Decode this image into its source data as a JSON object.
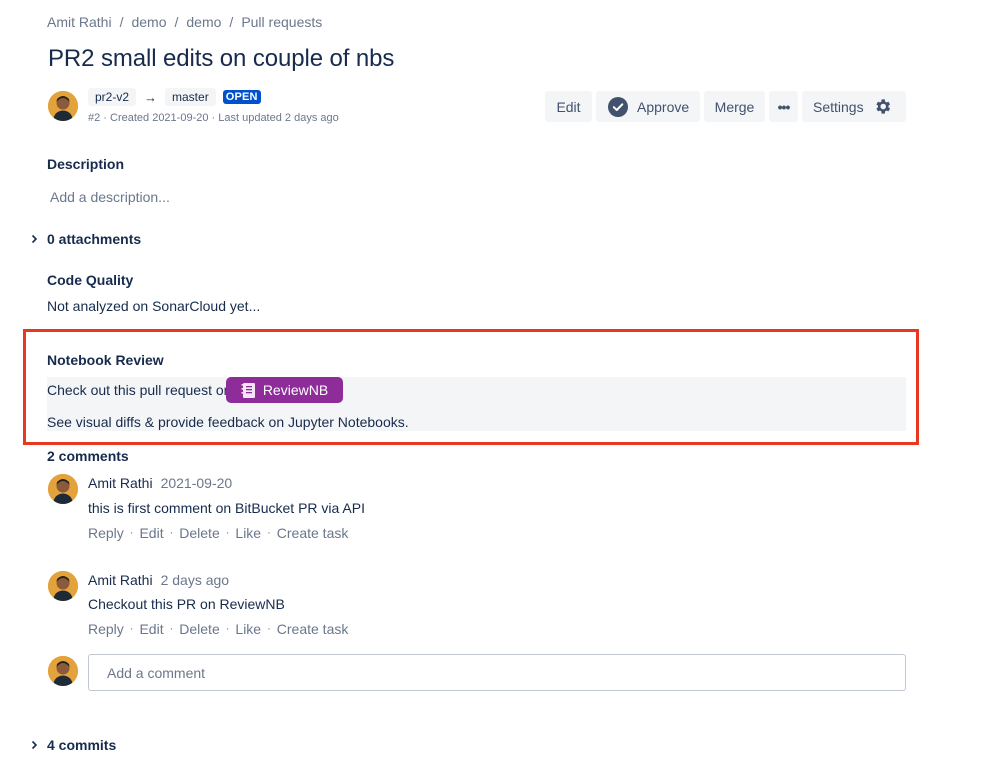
{
  "breadcrumb": [
    "Amit Rathi",
    "demo",
    "demo",
    "Pull requests"
  ],
  "breadcrumb_sep": "/",
  "pr": {
    "title": "PR2 small edits on couple of nbs",
    "source_branch": "pr2-v2",
    "target_branch": "master",
    "status": "OPEN",
    "meta": "#2 · Created 2021-09-20 · Last updated 2 days ago"
  },
  "toolbar": {
    "edit": "Edit",
    "approve": "Approve",
    "merge": "Merge",
    "more": "•••",
    "settings": "Settings"
  },
  "description": {
    "title": "Description",
    "placeholder": "Add a description..."
  },
  "attachments": {
    "label": "0 attachments"
  },
  "code_quality": {
    "title": "Code Quality",
    "text": "Not analyzed on SonarCloud yet..."
  },
  "notebook_review": {
    "title": "Notebook Review",
    "prompt": "Check out this pull request on",
    "button": "ReviewNB",
    "subtext": "See visual diffs & provide feedback on Jupyter Notebooks."
  },
  "comments": {
    "title": "2 comments",
    "items": [
      {
        "author": "Amit Rathi",
        "date": "2021-09-20",
        "text": "this is first comment on BitBucket PR via API"
      },
      {
        "author": "Amit Rathi",
        "date": "2 days ago",
        "text": "Checkout this PR on ReviewNB"
      }
    ],
    "actions": [
      "Reply",
      "Edit",
      "Delete",
      "Like",
      "Create task"
    ],
    "add_placeholder": "Add a comment"
  },
  "commits": {
    "label": "4 commits"
  },
  "colors": {
    "accent": "#0052cc",
    "reviewnb": "#8e2c9a",
    "highlight": "#e8381f"
  }
}
